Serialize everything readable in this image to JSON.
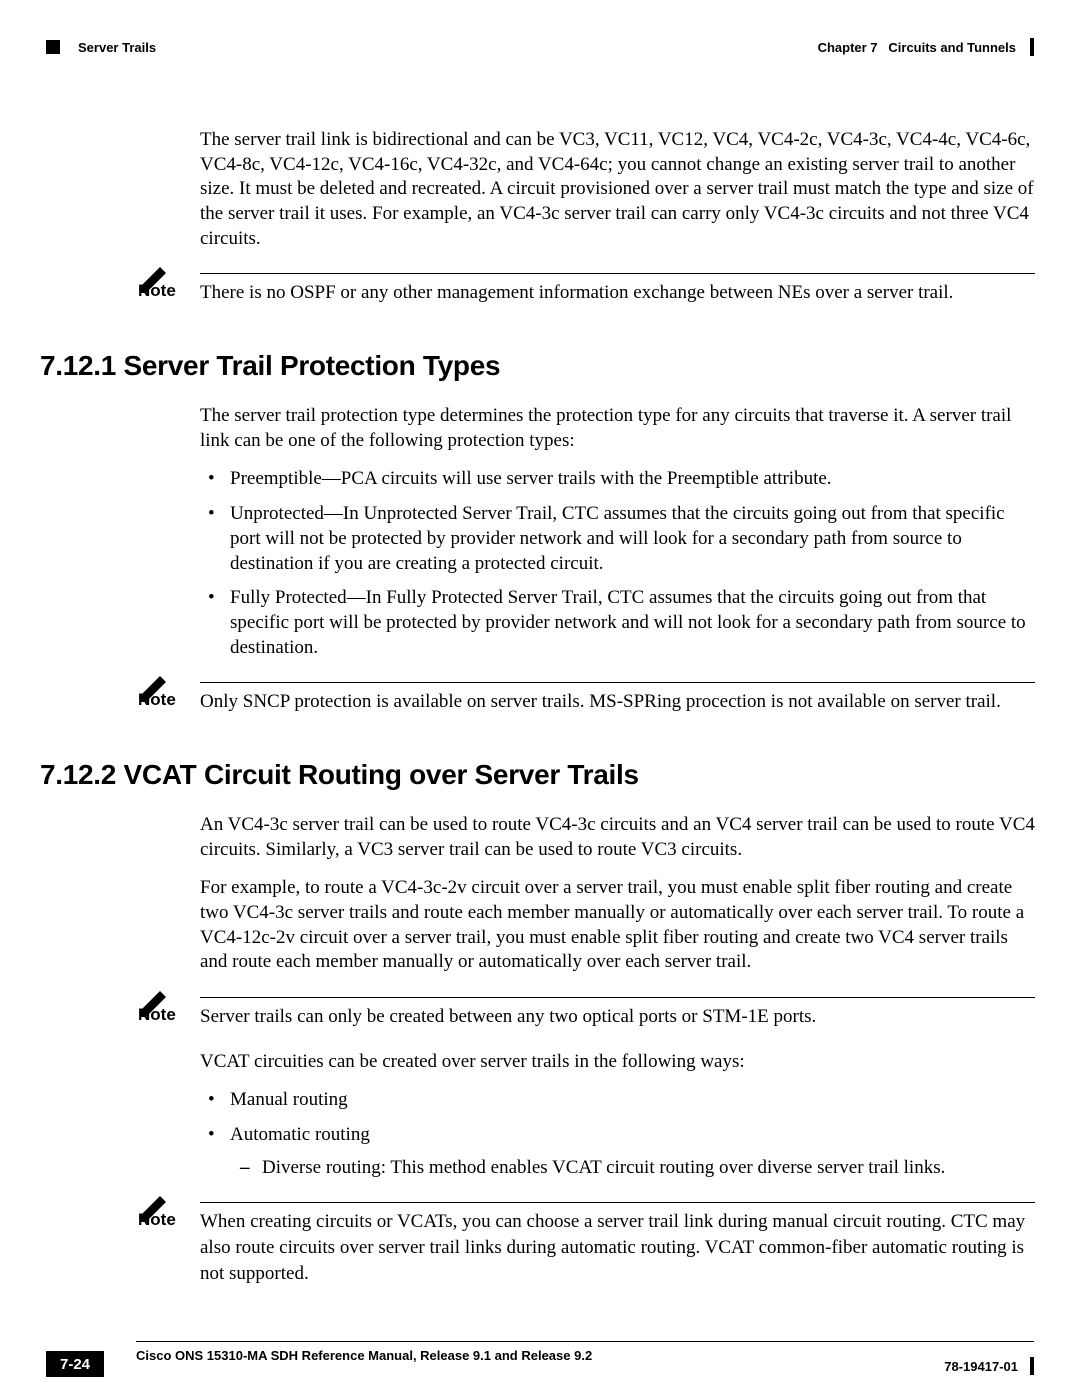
{
  "header": {
    "section_left": "Server Trails",
    "chapter_label": "Chapter 7",
    "chapter_title": "Circuits and Tunnels"
  },
  "intro_para": "The server trail link is bidirectional and can be VC3, VC11, VC12, VC4, VC4-2c, VC4-3c, VC4-4c, VC4-6c, VC4-8c, VC4-12c, VC4-16c, VC4-32c, and VC4-64c; you cannot change an existing server trail to another size. It must be deleted and recreated. A circuit provisioned over a server trail must match the type and size of the server trail it uses. For example, an VC4-3c server trail can carry only VC4-3c circuits and not three VC4 circuits.",
  "note1": {
    "label": "Note",
    "text": "There is no OSPF or any other management information exchange between NEs over a server trail."
  },
  "section1": {
    "heading": "7.12.1  Server Trail Protection Types",
    "intro": "The server trail protection type determines the protection type for any circuits that traverse it. A server trail link can be one of the following protection types:",
    "bullets": [
      "Preemptible—PCA circuits will use server trails with the Preemptible attribute.",
      "Unprotected—In Unprotected Server Trail, CTC assumes that the circuits going out from that specific port will not be protected by provider network and will look for a secondary path from source to destination if you are creating a protected circuit.",
      "Fully Protected—In Fully Protected Server Trail, CTC assumes that the circuits going out from that specific port will be protected by provider network and will not look for a secondary path from source to destination."
    ],
    "note": {
      "label": "Note",
      "text": "Only SNCP protection is available on server trails. MS-SPRing procection is not available on server trail."
    }
  },
  "section2": {
    "heading": "7.12.2  VCAT Circuit Routing over Server Trails",
    "para1": "An VC4-3c server trail can be used to route VC4-3c circuits and an VC4 server trail can be used to route VC4 circuits. Similarly, a VC3 server trail can be used to route VC3 circuits.",
    "para2": "For example, to route a VC4-3c-2v circuit over a server trail, you must enable split fiber routing and create two VC4-3c server trails and route each member manually or automatically over each server trail. To route a VC4-12c-2v circuit over a server trail, you must enable split fiber routing and create two VC4 server trails and route each member manually or automatically over each server trail.",
    "note1": {
      "label": "Note",
      "text": "Server trails can only be created between any two optical ports or STM-1E ports."
    },
    "para3": "VCAT circuities can be created over server trails in the following ways:",
    "bullets": [
      "Manual routing",
      "Automatic routing"
    ],
    "sub_bullet": "Diverse routing: This method enables VCAT circuit routing over diverse server trail links.",
    "note2": {
      "label": "Note",
      "text": "When creating circuits or VCATs, you can choose a server trail link during manual circuit routing. CTC may also route circuits over server trail links during automatic routing. VCAT common-fiber automatic routing is not supported."
    }
  },
  "footer": {
    "manual_title": "Cisco ONS 15310-MA SDH Reference Manual, Release 9.1 and Release 9.2",
    "page_number": "7-24",
    "doc_number": "78-19417-01"
  }
}
